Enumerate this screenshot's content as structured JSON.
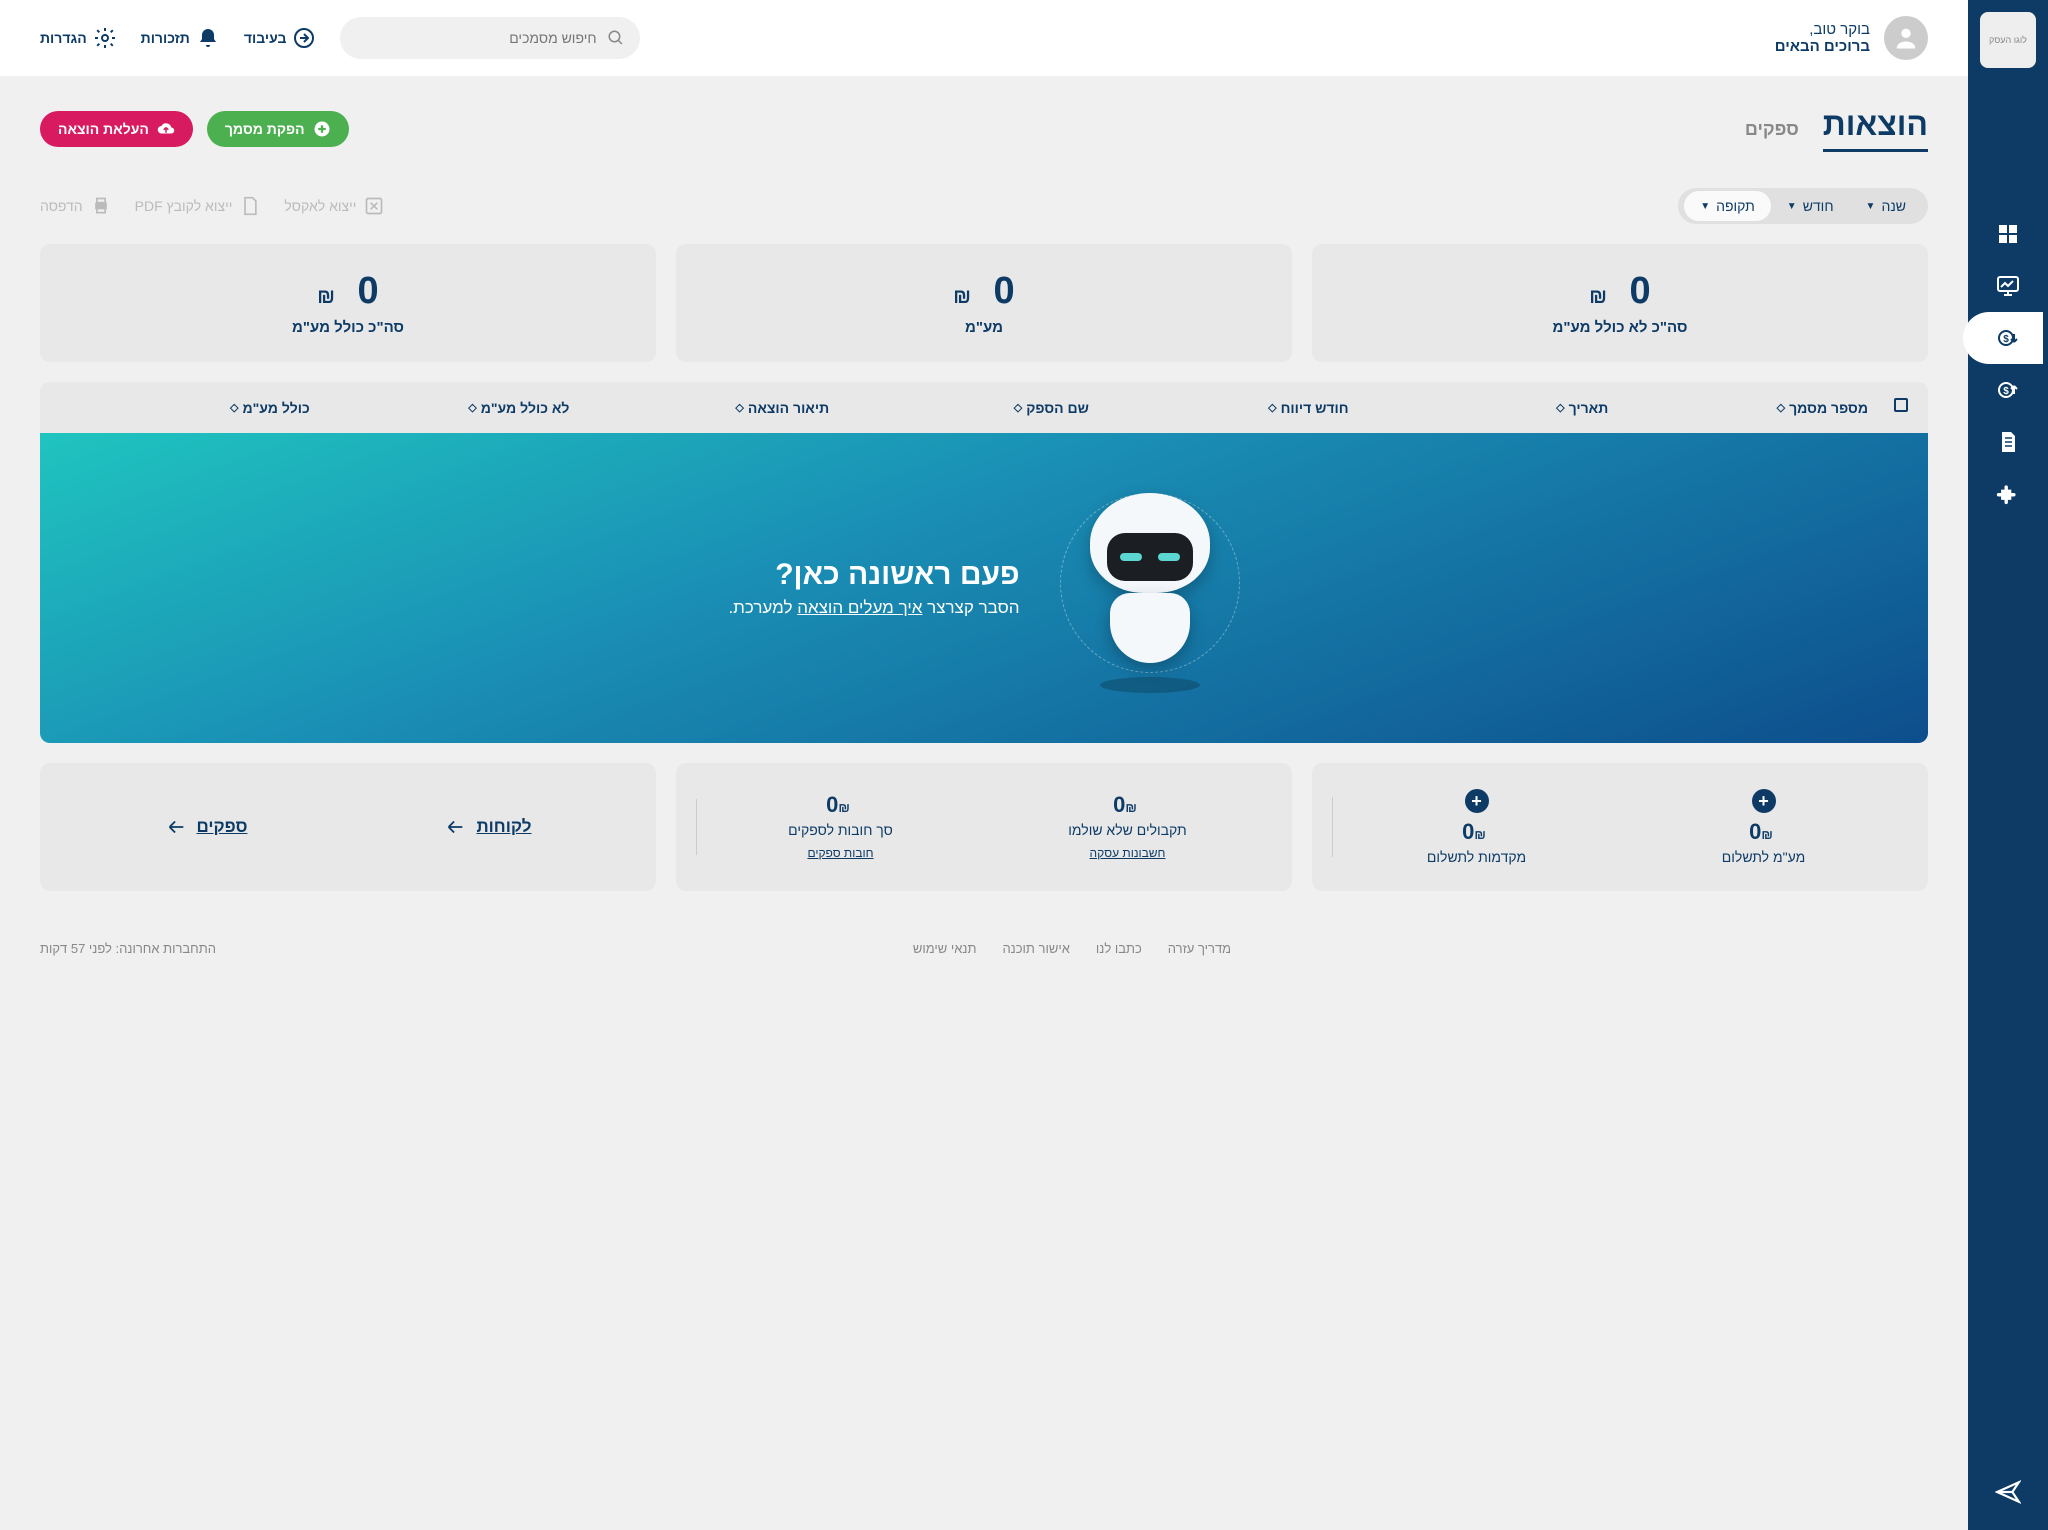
{
  "sidebar": {
    "logo_text": "לוגו העסק"
  },
  "greeting": {
    "line1": "בוקר טוב,",
    "line2": "ברוכים הבאים"
  },
  "search": {
    "placeholder": "חיפוש מסמכים"
  },
  "top_actions": {
    "processing": "בעיבוד",
    "reminders": "תזכורות",
    "settings": "הגדרות"
  },
  "tabs": {
    "expenses": "הוצאות",
    "suppliers": "ספקים"
  },
  "buttons": {
    "generate_doc": "הפקת מסמך",
    "upload_expense": "העלאת הוצאה"
  },
  "filters": {
    "year": "שנה",
    "month": "חודש",
    "period": "תקופה"
  },
  "exports": {
    "excel": "ייצוא לאקסל",
    "pdf": "ייצוא לקובץ PDF",
    "print": "הדפסה"
  },
  "summary": [
    {
      "value": "0",
      "currency": "₪",
      "label": "סה\"כ לא כולל מע\"מ"
    },
    {
      "value": "0",
      "currency": "₪",
      "label": "מע\"מ"
    },
    {
      "value": "0",
      "currency": "₪",
      "label": "סה\"כ כולל מע\"מ"
    }
  ],
  "table": {
    "columns": [
      "מספר מסמך",
      "תאריך",
      "חודש דיווח",
      "שם הספק",
      "תיאור הוצאה",
      "לא כולל מע\"מ",
      "כולל מע\"מ"
    ]
  },
  "empty": {
    "title": "פעם ראשונה כאן?",
    "subtitle_pre": "הסבר קצרצר ",
    "subtitle_link": "איך מעלים הוצאה",
    "subtitle_post": " למערכת."
  },
  "bottom": {
    "vat": {
      "value": "0",
      "currency": "₪",
      "label": "מע\"מ לתשלום"
    },
    "advances": {
      "value": "0",
      "currency": "₪",
      "label": "מקדמות לתשלום"
    },
    "unpaid": {
      "value": "0",
      "currency": "₪",
      "label": "תקבולים שלא שולמו",
      "link": "חשבונות עסקה"
    },
    "debts": {
      "value": "0",
      "currency": "₪",
      "label": "סך חובות לספקים",
      "link": "חובות ספקים"
    },
    "nav_customers": "לקוחות",
    "nav_suppliers": "ספקים"
  },
  "footer": {
    "links": [
      "מדריך עזרה",
      "כתבו לנו",
      "אישור תוכנה",
      "תנאי שימוש"
    ],
    "last_login": "התחברות אחרונה: לפני 57 דקות"
  }
}
